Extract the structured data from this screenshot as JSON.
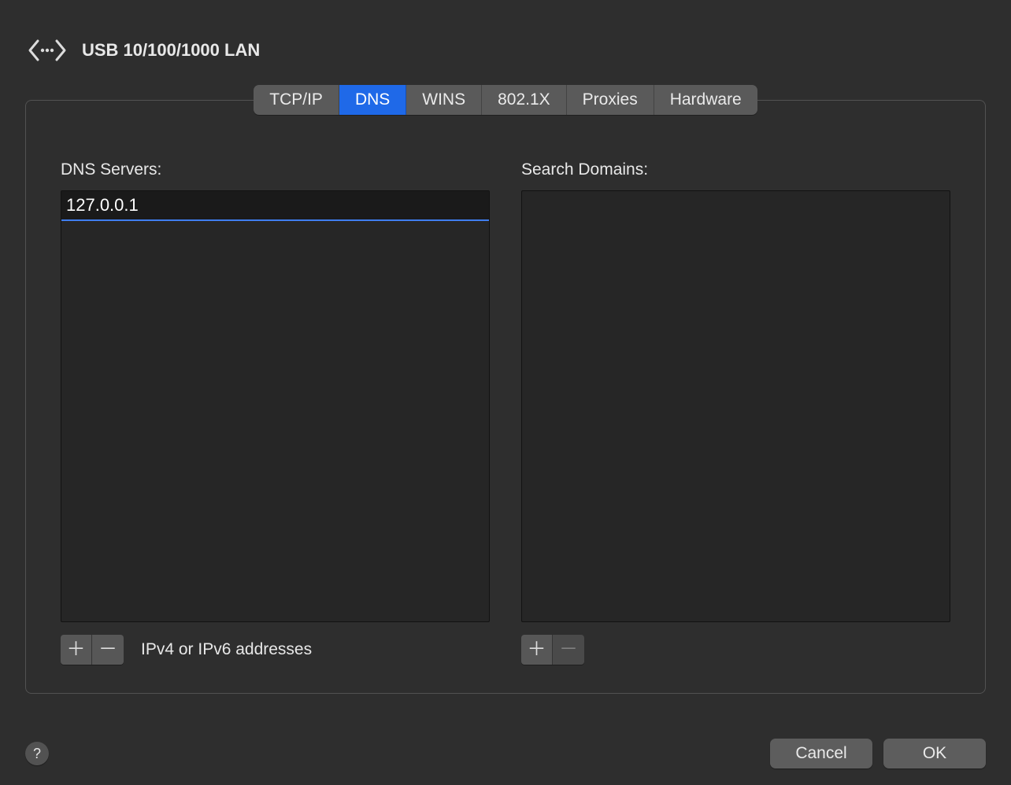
{
  "header": {
    "title": "USB 10/100/1000 LAN"
  },
  "tabs": [
    {
      "label": "TCP/IP"
    },
    {
      "label": "DNS"
    },
    {
      "label": "WINS"
    },
    {
      "label": "802.1X"
    },
    {
      "label": "Proxies"
    },
    {
      "label": "Hardware"
    }
  ],
  "dns": {
    "label": "DNS Servers:",
    "editing_value": "127.0.0.1",
    "hint": "IPv4 or IPv6 addresses"
  },
  "search_domains": {
    "label": "Search Domains:"
  },
  "buttons": {
    "help": "?",
    "cancel": "Cancel",
    "ok": "OK",
    "plus": "＋",
    "minus": "－"
  }
}
